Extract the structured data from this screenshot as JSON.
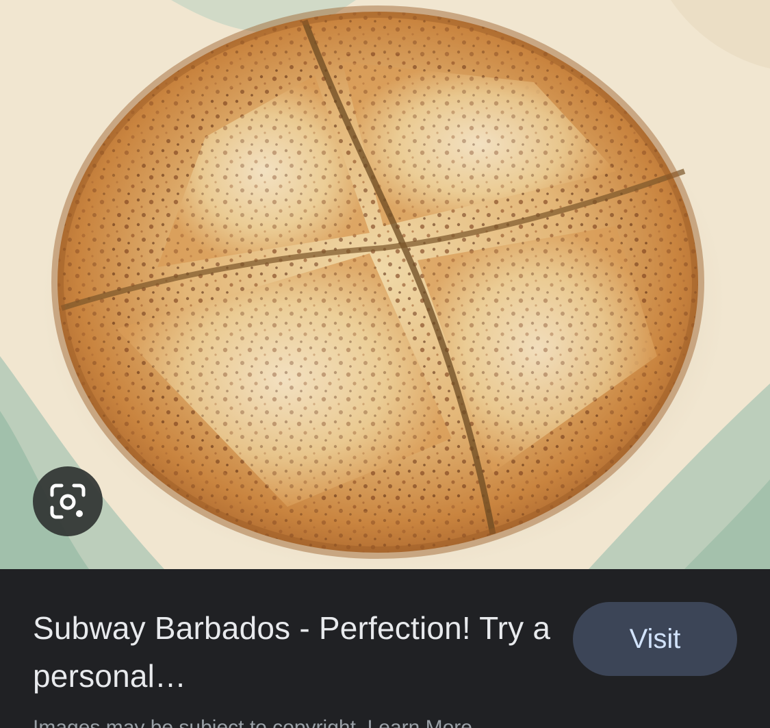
{
  "image": {
    "alt": "",
    "lens_icon": "google-lens-icon"
  },
  "result": {
    "title": "Subway Barbados - Perfection! Try a personal…",
    "visit_label": "Visit",
    "caption": "Images may be subject to copyright. Learn More"
  },
  "colors": {
    "panel_background": "#202124",
    "title_text": "#e8eaed",
    "visit_button_bg": "#3c4557",
    "visit_button_text": "#d2e3fc"
  }
}
